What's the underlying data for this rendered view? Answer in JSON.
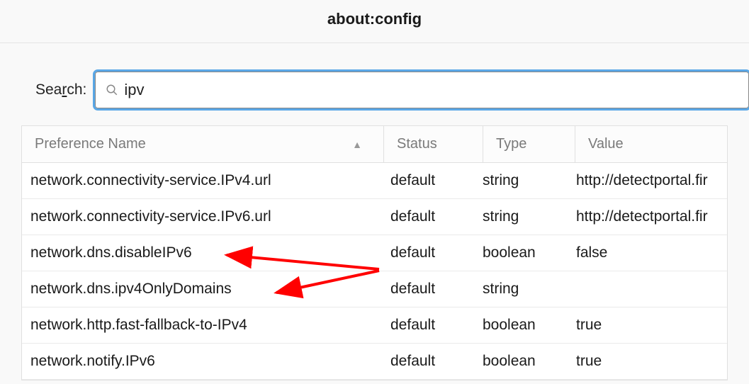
{
  "header": {
    "title": "about:config"
  },
  "search": {
    "label_pre": "Sea",
    "label_underlined": "r",
    "label_post": "ch:",
    "value": "ipv"
  },
  "columns": {
    "name": "Preference Name",
    "status": "Status",
    "type": "Type",
    "value": "Value",
    "sort_indicator": "▲"
  },
  "rows": [
    {
      "name": "network.connectivity-service.IPv4.url",
      "status": "default",
      "type": "string",
      "value": "http://detectportal.fir"
    },
    {
      "name": "network.connectivity-service.IPv6.url",
      "status": "default",
      "type": "string",
      "value": "http://detectportal.fir"
    },
    {
      "name": "network.dns.disableIPv6",
      "status": "default",
      "type": "boolean",
      "value": "false"
    },
    {
      "name": "network.dns.ipv4OnlyDomains",
      "status": "default",
      "type": "string",
      "value": ""
    },
    {
      "name": "network.http.fast-fallback-to-IPv4",
      "status": "default",
      "type": "boolean",
      "value": "true"
    },
    {
      "name": "network.notify.IPv6",
      "status": "default",
      "type": "boolean",
      "value": "true"
    }
  ],
  "annotation": {
    "color": "#ff0000"
  }
}
